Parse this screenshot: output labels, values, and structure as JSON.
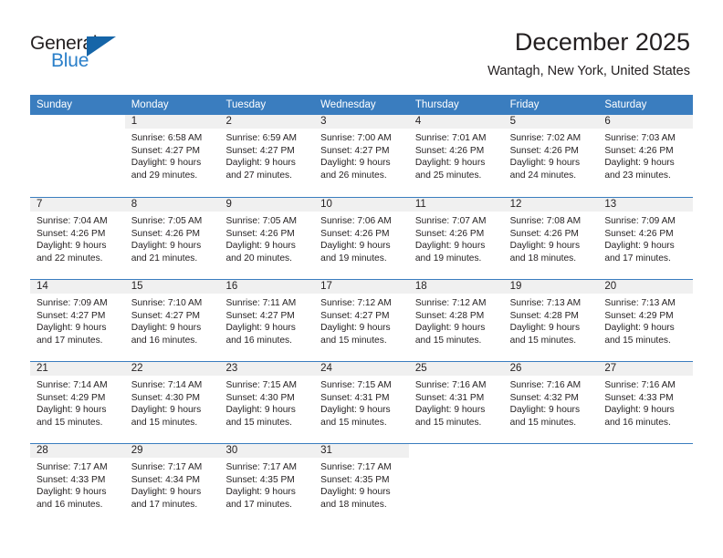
{
  "brand": {
    "name_top": "General",
    "name_bottom": "Blue",
    "accent_color": "#2a7fc9",
    "triangle_color": "#1565a8"
  },
  "header": {
    "title": "December 2025",
    "subtitle": "Wantagh, New York, United States"
  },
  "calendar": {
    "header_bg": "#3a7dbf",
    "day_band_bg": "#f0f0f0",
    "weekdays": [
      "Sunday",
      "Monday",
      "Tuesday",
      "Wednesday",
      "Thursday",
      "Friday",
      "Saturday"
    ],
    "weeks": [
      [
        {
          "date": "",
          "lines": []
        },
        {
          "date": "1",
          "lines": [
            "Sunrise: 6:58 AM",
            "Sunset: 4:27 PM",
            "Daylight: 9 hours",
            "and 29 minutes."
          ]
        },
        {
          "date": "2",
          "lines": [
            "Sunrise: 6:59 AM",
            "Sunset: 4:27 PM",
            "Daylight: 9 hours",
            "and 27 minutes."
          ]
        },
        {
          "date": "3",
          "lines": [
            "Sunrise: 7:00 AM",
            "Sunset: 4:27 PM",
            "Daylight: 9 hours",
            "and 26 minutes."
          ]
        },
        {
          "date": "4",
          "lines": [
            "Sunrise: 7:01 AM",
            "Sunset: 4:26 PM",
            "Daylight: 9 hours",
            "and 25 minutes."
          ]
        },
        {
          "date": "5",
          "lines": [
            "Sunrise: 7:02 AM",
            "Sunset: 4:26 PM",
            "Daylight: 9 hours",
            "and 24 minutes."
          ]
        },
        {
          "date": "6",
          "lines": [
            "Sunrise: 7:03 AM",
            "Sunset: 4:26 PM",
            "Daylight: 9 hours",
            "and 23 minutes."
          ]
        }
      ],
      [
        {
          "date": "7",
          "lines": [
            "Sunrise: 7:04 AM",
            "Sunset: 4:26 PM",
            "Daylight: 9 hours",
            "and 22 minutes."
          ]
        },
        {
          "date": "8",
          "lines": [
            "Sunrise: 7:05 AM",
            "Sunset: 4:26 PM",
            "Daylight: 9 hours",
            "and 21 minutes."
          ]
        },
        {
          "date": "9",
          "lines": [
            "Sunrise: 7:05 AM",
            "Sunset: 4:26 PM",
            "Daylight: 9 hours",
            "and 20 minutes."
          ]
        },
        {
          "date": "10",
          "lines": [
            "Sunrise: 7:06 AM",
            "Sunset: 4:26 PM",
            "Daylight: 9 hours",
            "and 19 minutes."
          ]
        },
        {
          "date": "11",
          "lines": [
            "Sunrise: 7:07 AM",
            "Sunset: 4:26 PM",
            "Daylight: 9 hours",
            "and 19 minutes."
          ]
        },
        {
          "date": "12",
          "lines": [
            "Sunrise: 7:08 AM",
            "Sunset: 4:26 PM",
            "Daylight: 9 hours",
            "and 18 minutes."
          ]
        },
        {
          "date": "13",
          "lines": [
            "Sunrise: 7:09 AM",
            "Sunset: 4:26 PM",
            "Daylight: 9 hours",
            "and 17 minutes."
          ]
        }
      ],
      [
        {
          "date": "14",
          "lines": [
            "Sunrise: 7:09 AM",
            "Sunset: 4:27 PM",
            "Daylight: 9 hours",
            "and 17 minutes."
          ]
        },
        {
          "date": "15",
          "lines": [
            "Sunrise: 7:10 AM",
            "Sunset: 4:27 PM",
            "Daylight: 9 hours",
            "and 16 minutes."
          ]
        },
        {
          "date": "16",
          "lines": [
            "Sunrise: 7:11 AM",
            "Sunset: 4:27 PM",
            "Daylight: 9 hours",
            "and 16 minutes."
          ]
        },
        {
          "date": "17",
          "lines": [
            "Sunrise: 7:12 AM",
            "Sunset: 4:27 PM",
            "Daylight: 9 hours",
            "and 15 minutes."
          ]
        },
        {
          "date": "18",
          "lines": [
            "Sunrise: 7:12 AM",
            "Sunset: 4:28 PM",
            "Daylight: 9 hours",
            "and 15 minutes."
          ]
        },
        {
          "date": "19",
          "lines": [
            "Sunrise: 7:13 AM",
            "Sunset: 4:28 PM",
            "Daylight: 9 hours",
            "and 15 minutes."
          ]
        },
        {
          "date": "20",
          "lines": [
            "Sunrise: 7:13 AM",
            "Sunset: 4:29 PM",
            "Daylight: 9 hours",
            "and 15 minutes."
          ]
        }
      ],
      [
        {
          "date": "21",
          "lines": [
            "Sunrise: 7:14 AM",
            "Sunset: 4:29 PM",
            "Daylight: 9 hours",
            "and 15 minutes."
          ]
        },
        {
          "date": "22",
          "lines": [
            "Sunrise: 7:14 AM",
            "Sunset: 4:30 PM",
            "Daylight: 9 hours",
            "and 15 minutes."
          ]
        },
        {
          "date": "23",
          "lines": [
            "Sunrise: 7:15 AM",
            "Sunset: 4:30 PM",
            "Daylight: 9 hours",
            "and 15 minutes."
          ]
        },
        {
          "date": "24",
          "lines": [
            "Sunrise: 7:15 AM",
            "Sunset: 4:31 PM",
            "Daylight: 9 hours",
            "and 15 minutes."
          ]
        },
        {
          "date": "25",
          "lines": [
            "Sunrise: 7:16 AM",
            "Sunset: 4:31 PM",
            "Daylight: 9 hours",
            "and 15 minutes."
          ]
        },
        {
          "date": "26",
          "lines": [
            "Sunrise: 7:16 AM",
            "Sunset: 4:32 PM",
            "Daylight: 9 hours",
            "and 15 minutes."
          ]
        },
        {
          "date": "27",
          "lines": [
            "Sunrise: 7:16 AM",
            "Sunset: 4:33 PM",
            "Daylight: 9 hours",
            "and 16 minutes."
          ]
        }
      ],
      [
        {
          "date": "28",
          "lines": [
            "Sunrise: 7:17 AM",
            "Sunset: 4:33 PM",
            "Daylight: 9 hours",
            "and 16 minutes."
          ]
        },
        {
          "date": "29",
          "lines": [
            "Sunrise: 7:17 AM",
            "Sunset: 4:34 PM",
            "Daylight: 9 hours",
            "and 17 minutes."
          ]
        },
        {
          "date": "30",
          "lines": [
            "Sunrise: 7:17 AM",
            "Sunset: 4:35 PM",
            "Daylight: 9 hours",
            "and 17 minutes."
          ]
        },
        {
          "date": "31",
          "lines": [
            "Sunrise: 7:17 AM",
            "Sunset: 4:35 PM",
            "Daylight: 9 hours",
            "and 18 minutes."
          ]
        },
        {
          "date": "",
          "lines": []
        },
        {
          "date": "",
          "lines": []
        },
        {
          "date": "",
          "lines": []
        }
      ]
    ]
  }
}
